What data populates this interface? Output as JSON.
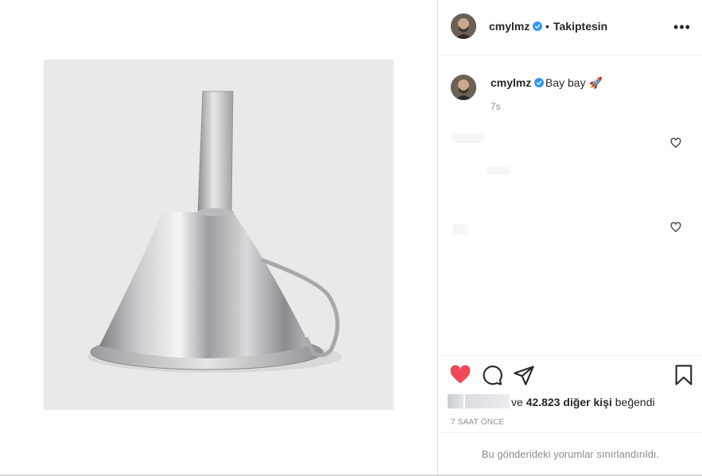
{
  "post": {
    "image_subject": "funnel",
    "brand_heart_color": "#ed4956"
  },
  "header": {
    "username": "cmylmz",
    "verified_icon": "verified-badge-icon",
    "separator": "•",
    "follow_status": "Takiptesin",
    "more_icon": "more-options-icon"
  },
  "caption": {
    "username": "cmylmz",
    "text": "Bay bay 🚀",
    "time": "7s"
  },
  "actions": {
    "like_icon": "heart-filled-icon",
    "comment_icon": "comment-icon",
    "share_icon": "share-icon",
    "save_icon": "bookmark-icon",
    "likes_prefix": "ve ",
    "likes_count": "42.823 diğer kişi",
    "likes_suffix": " beğendi",
    "post_age": "7 SAAT ÖNCE"
  },
  "footer": {
    "comments_notice": "Bu gönderideki yorumlar sınırlandırıldı."
  }
}
